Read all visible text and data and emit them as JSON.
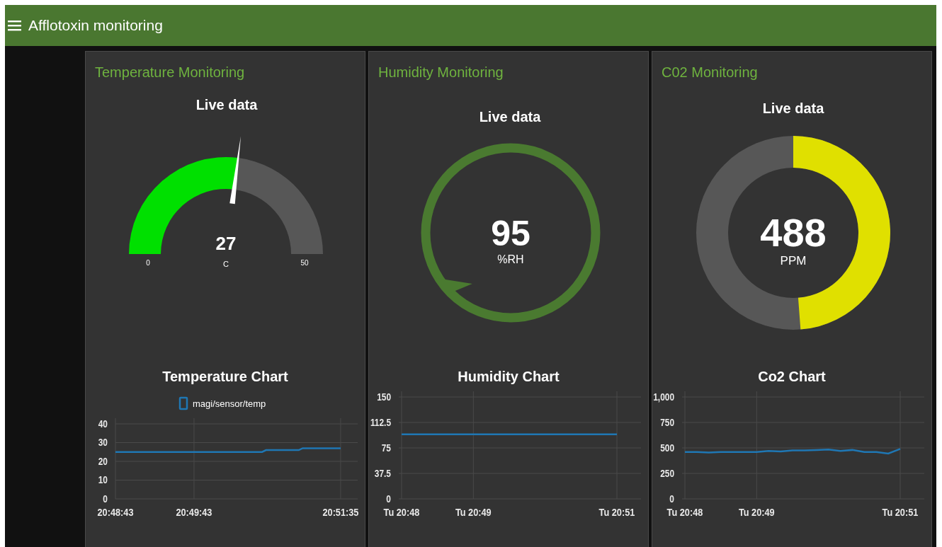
{
  "header": {
    "title": "Afflotoxin monitoring"
  },
  "cards": [
    {
      "title": "Temperature Monitoring",
      "widget": {
        "kind": "gauge",
        "label": "Live data",
        "value": "27",
        "units": "C",
        "min": "0",
        "max": "50",
        "level": 0.54
      },
      "chart": {
        "chart_data": {
          "type": "line",
          "title": "Temperature Chart",
          "grid": true,
          "x": [
            74923,
            75035,
            75038,
            75063,
            75066,
            75095
          ],
          "series": [
            {
              "name": "magi/sensor/temp",
              "color": "#1f77b4",
              "values": [
                25,
                25,
                26,
                26,
                27,
                27
              ]
            }
          ],
          "xlim": [
            74923,
            75108
          ],
          "ylim": [
            0,
            40
          ],
          "xticks": [
            {
              "value": 74923,
              "label": "20:48:43"
            },
            {
              "value": 74983,
              "label": "20:49:43"
            },
            {
              "value": 75095,
              "label": "20:51:35"
            }
          ],
          "yticks": [
            {
              "value": 0,
              "label": "0"
            },
            {
              "value": 10,
              "label": "10"
            },
            {
              "value": 20,
              "label": "20"
            },
            {
              "value": 30,
              "label": "30"
            },
            {
              "value": 40,
              "label": "40"
            }
          ]
        }
      }
    },
    {
      "title": "Humidity Monitoring",
      "widget": {
        "kind": "compass",
        "label": "Live data",
        "value": "95",
        "units": "%RH"
      },
      "chart": {
        "chart_data": {
          "type": "line",
          "title": "Humidity Chart",
          "grid": true,
          "categories": [
            "Tu 20:48",
            null,
            "Tu 20:49",
            null,
            null,
            null,
            "Tu 20:51"
          ],
          "series": [
            {
              "color": "#1f77b4",
              "values": [
                95,
                95,
                95,
                95,
                95,
                95,
                95
              ]
            }
          ],
          "ylim": [
            0,
            150
          ],
          "yticks": [
            {
              "value": 0,
              "label": "0"
            },
            {
              "value": 37.5,
              "label": "37.5"
            },
            {
              "value": 75,
              "label": "75"
            },
            {
              "value": 112.5,
              "label": "112.5"
            },
            {
              "value": 150,
              "label": "150"
            }
          ]
        }
      }
    },
    {
      "title": "C02 Monitoring",
      "widget": {
        "kind": "donut",
        "label": "Live data",
        "value": "488",
        "units": "PPM",
        "level": 0.488
      },
      "chart": {
        "chart_data": {
          "type": "line",
          "title": "Co2 Chart",
          "grid": true,
          "categories": [
            "Tu 20:48",
            null,
            null,
            null,
            null,
            null,
            "Tu 20:49",
            null,
            null,
            null,
            null,
            null,
            null,
            null,
            null,
            null,
            null,
            null,
            "Tu 20:51"
          ],
          "series": [
            {
              "color": "#1f77b4",
              "values": [
                460,
                460,
                455,
                460,
                460,
                460,
                460,
                470,
                465,
                475,
                475,
                480,
                485,
                470,
                480,
                460,
                460,
                445,
                490
              ]
            }
          ],
          "ylim": [
            0,
            1000
          ],
          "yticks": [
            {
              "value": 0,
              "label": "0"
            },
            {
              "value": 250,
              "label": "250"
            },
            {
              "value": 500,
              "label": "500"
            },
            {
              "value": 750,
              "label": "750"
            },
            {
              "value": 1000,
              "label": "1,000"
            }
          ]
        }
      }
    }
  ]
}
